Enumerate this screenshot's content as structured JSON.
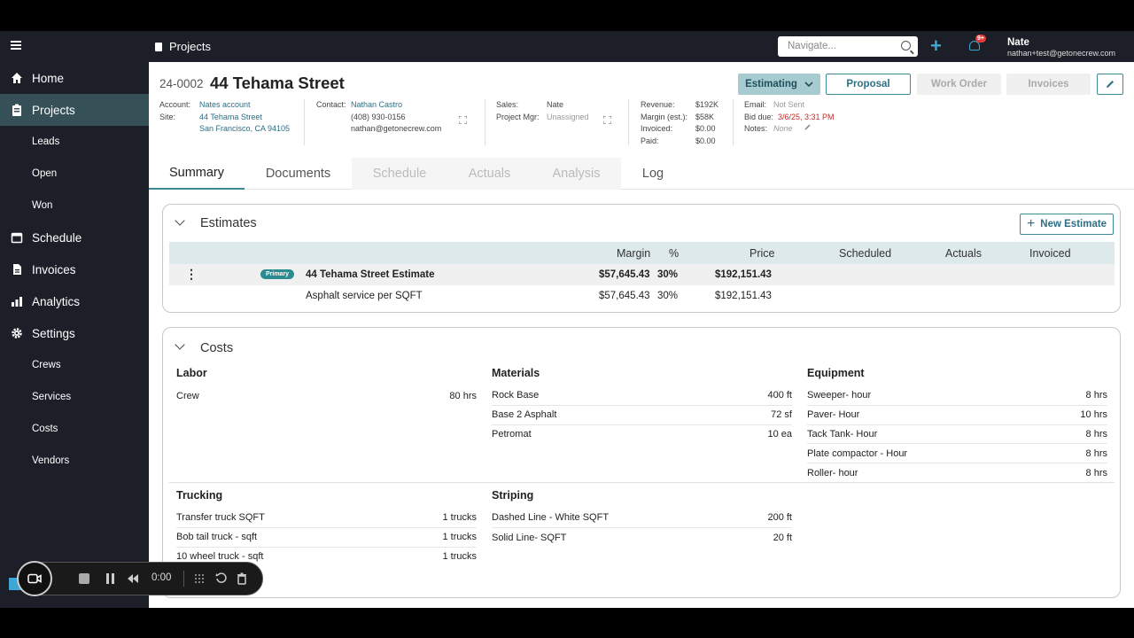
{
  "topbar": {
    "crumb": "Projects",
    "navigate_placeholder": "Navigate...",
    "badge": "9+",
    "user_name": "Nate",
    "user_email": "nathan+test@getonecrew.com"
  },
  "sidebar": {
    "items": [
      {
        "label": "Home"
      },
      {
        "label": "Projects"
      },
      {
        "label": "Leads"
      },
      {
        "label": "Open"
      },
      {
        "label": "Won"
      },
      {
        "label": "Schedule"
      },
      {
        "label": "Invoices"
      },
      {
        "label": "Analytics"
      },
      {
        "label": "Settings"
      },
      {
        "label": "Crews"
      },
      {
        "label": "Services"
      },
      {
        "label": "Costs"
      },
      {
        "label": "Vendors"
      }
    ],
    "recorder_time": "0:00"
  },
  "project": {
    "id": "24-0002",
    "name": "44 Tehama Street",
    "status": "Estimating",
    "buttons": {
      "proposal": "Proposal",
      "work_order": "Work Order",
      "invoices": "Invoices"
    },
    "account_label": "Account:",
    "account": "Nates account",
    "site_label": "Site:",
    "site_line1": "44 Tehama Street",
    "site_line2": "San Francisco, CA 94105",
    "contact_label": "Contact:",
    "contact": "Nathan Castro",
    "phone": "(408) 930-0156",
    "email_addr": "nathan@getonecrew.com",
    "sales_label": "Sales:",
    "sales": "Nate",
    "pm_label": "Project Mgr:",
    "pm": "Unassigned",
    "revenue_label": "Revenue:",
    "revenue": "$192K",
    "margin_label": "Margin (est.):",
    "margin": "$58K",
    "invoiced_label": "Invoiced:",
    "invoiced": "$0.00",
    "paid_label": "Paid:",
    "paid": "$0.00",
    "email_label": "Email:",
    "email_status": "Not Sent",
    "bid_label": "Bid due:",
    "bid_due": "3/6/25, 3:31 PM",
    "notes_label": "Notes:",
    "notes": "None"
  },
  "tabs": [
    "Summary",
    "Documents",
    "Schedule",
    "Actuals",
    "Analysis",
    "Log"
  ],
  "estimates": {
    "title": "Estimates",
    "new_button": "New Estimate",
    "columns": {
      "margin": "Margin",
      "pct": "%",
      "price": "Price",
      "scheduled": "Scheduled",
      "actuals": "Actuals",
      "invoiced": "Invoiced"
    },
    "rows": [
      {
        "badge": "Primary",
        "name": "44 Tehama Street Estimate",
        "margin": "$57,645.43",
        "pct": "30%",
        "price": "$192,151.43"
      },
      {
        "name": "Asphalt service per SQFT",
        "margin": "$57,645.43",
        "pct": "30%",
        "price": "$192,151.43"
      }
    ]
  },
  "costs": {
    "title": "Costs",
    "labor": {
      "title": "Labor",
      "items": [
        {
          "name": "Crew",
          "qty": "80 hrs"
        }
      ]
    },
    "materials": {
      "title": "Materials",
      "items": [
        {
          "name": "Rock Base",
          "qty": "400 ft"
        },
        {
          "name": "Base 2 Asphalt",
          "qty": "72 sf"
        },
        {
          "name": "Petromat",
          "qty": "10 ea"
        }
      ]
    },
    "equipment": {
      "title": "Equipment",
      "items": [
        {
          "name": "Sweeper- hour",
          "qty": "8 hrs"
        },
        {
          "name": "Paver- Hour",
          "qty": "10 hrs"
        },
        {
          "name": "Tack Tank- Hour",
          "qty": "8 hrs"
        },
        {
          "name": "Plate compactor - Hour",
          "qty": "8 hrs"
        },
        {
          "name": "Roller- hour",
          "qty": "8 hrs"
        }
      ]
    },
    "trucking": {
      "title": "Trucking",
      "items": [
        {
          "name": "Transfer truck SQFT",
          "qty": "1 trucks"
        },
        {
          "name": "Bob tail truck - sqft",
          "qty": "1 trucks"
        },
        {
          "name": "10 wheel truck - sqft",
          "qty": "1 trucks"
        }
      ]
    },
    "striping": {
      "title": "Striping",
      "items": [
        {
          "name": "Dashed Line - White SQFT",
          "qty": "200 ft"
        },
        {
          "name": "Solid Line- SQFT",
          "qty": "20 ft"
        }
      ]
    }
  },
  "colors": {
    "accent": "#3e8a96",
    "sidebar": "#1c1f28",
    "active": "#355057",
    "alert": "#c62828"
  }
}
